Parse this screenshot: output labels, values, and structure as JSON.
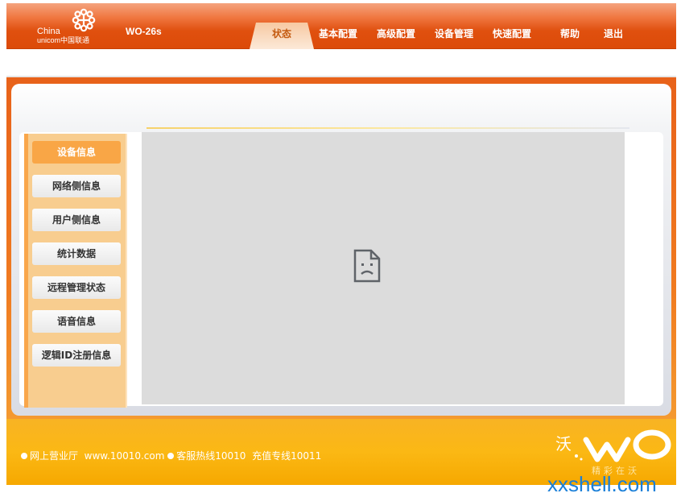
{
  "header": {
    "brand_en_1": "China",
    "brand_en_2": "unicom中国联通",
    "model": "WO-26s",
    "nav": {
      "status": "状态",
      "basic": "基本配置",
      "advanced": "高级配置",
      "device_mgmt": "设备管理",
      "quick": "快速配置",
      "help": "帮助",
      "logout": "退出"
    }
  },
  "sidebar": {
    "items": [
      {
        "label": "设备信息",
        "active": true
      },
      {
        "label": "网络侧信息",
        "active": false
      },
      {
        "label": "用户侧信息",
        "active": false
      },
      {
        "label": "统计数据",
        "active": false
      },
      {
        "label": "远程管理状态",
        "active": false
      },
      {
        "label": "语音信息",
        "active": false
      },
      {
        "label": "逻辑ID注册信息",
        "active": false
      }
    ]
  },
  "main": {
    "icon": "broken-page-icon"
  },
  "footer": {
    "text1": "网上营业厅",
    "text2": "www.10010.com",
    "text3": "客服热线10010",
    "text4": "充值专线10011",
    "slogan": "精彩在沃",
    "wo_char": "沃"
  },
  "watermark": "xxshell.com",
  "colors": {
    "brand_orange": "#e0500f",
    "sidebar_active": "#f9a646",
    "sidebar_bg": "#f8cd8f",
    "footer_yellow": "#fbb814"
  }
}
